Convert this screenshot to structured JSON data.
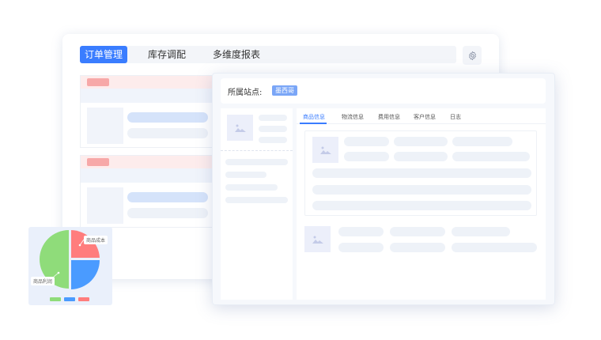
{
  "tabs": [
    {
      "label": "订单管理",
      "active": true
    },
    {
      "label": "库存调配",
      "active": false
    },
    {
      "label": "多维度报表",
      "active": false
    }
  ],
  "settings_icon": "gear-icon",
  "site": {
    "label": "所属站点:",
    "value": "墨西哥"
  },
  "detail_tabs": [
    "商品信息",
    "物流信息",
    "费用信息",
    "客户信息",
    "日志"
  ],
  "pie": {
    "labels": [
      "商品成本",
      "商品利润"
    ],
    "colors": {
      "green": "#8fdc7a",
      "red": "#ff7d7d",
      "blue": "#4a9bff"
    }
  },
  "colors": {
    "accent": "#3a7dff"
  }
}
